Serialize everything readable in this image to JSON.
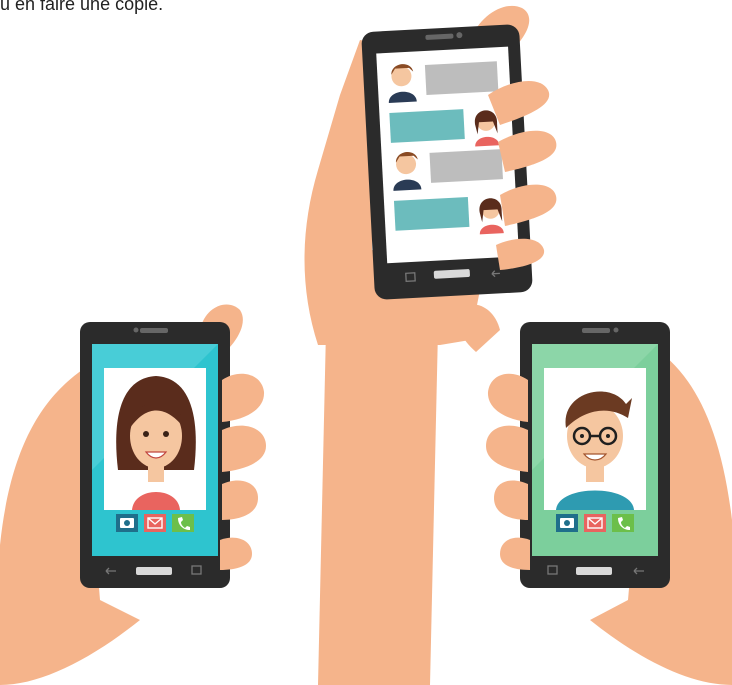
{
  "caption": {
    "text": "u en faire une copie."
  },
  "colors": {
    "skin": "#f5b48b",
    "skin_shadow": "#e89f77",
    "phone_body": "#2b2b2b",
    "phone_bezel": "#3a3a3a",
    "screen_chat": "#ffffff",
    "screen_left": "#2ec4cf",
    "screen_right": "#7ccf9c",
    "bubble_gray": "#bdbdbd",
    "bubble_teal": "#6cbcbd",
    "camera_button": "#1f6f8b",
    "mail_button": "#e9645f",
    "call_button": "#6cbf4a"
  },
  "icons": [
    "camera-icon",
    "mail-icon",
    "phone-icon",
    "back-icon",
    "recent-apps-icon"
  ]
}
